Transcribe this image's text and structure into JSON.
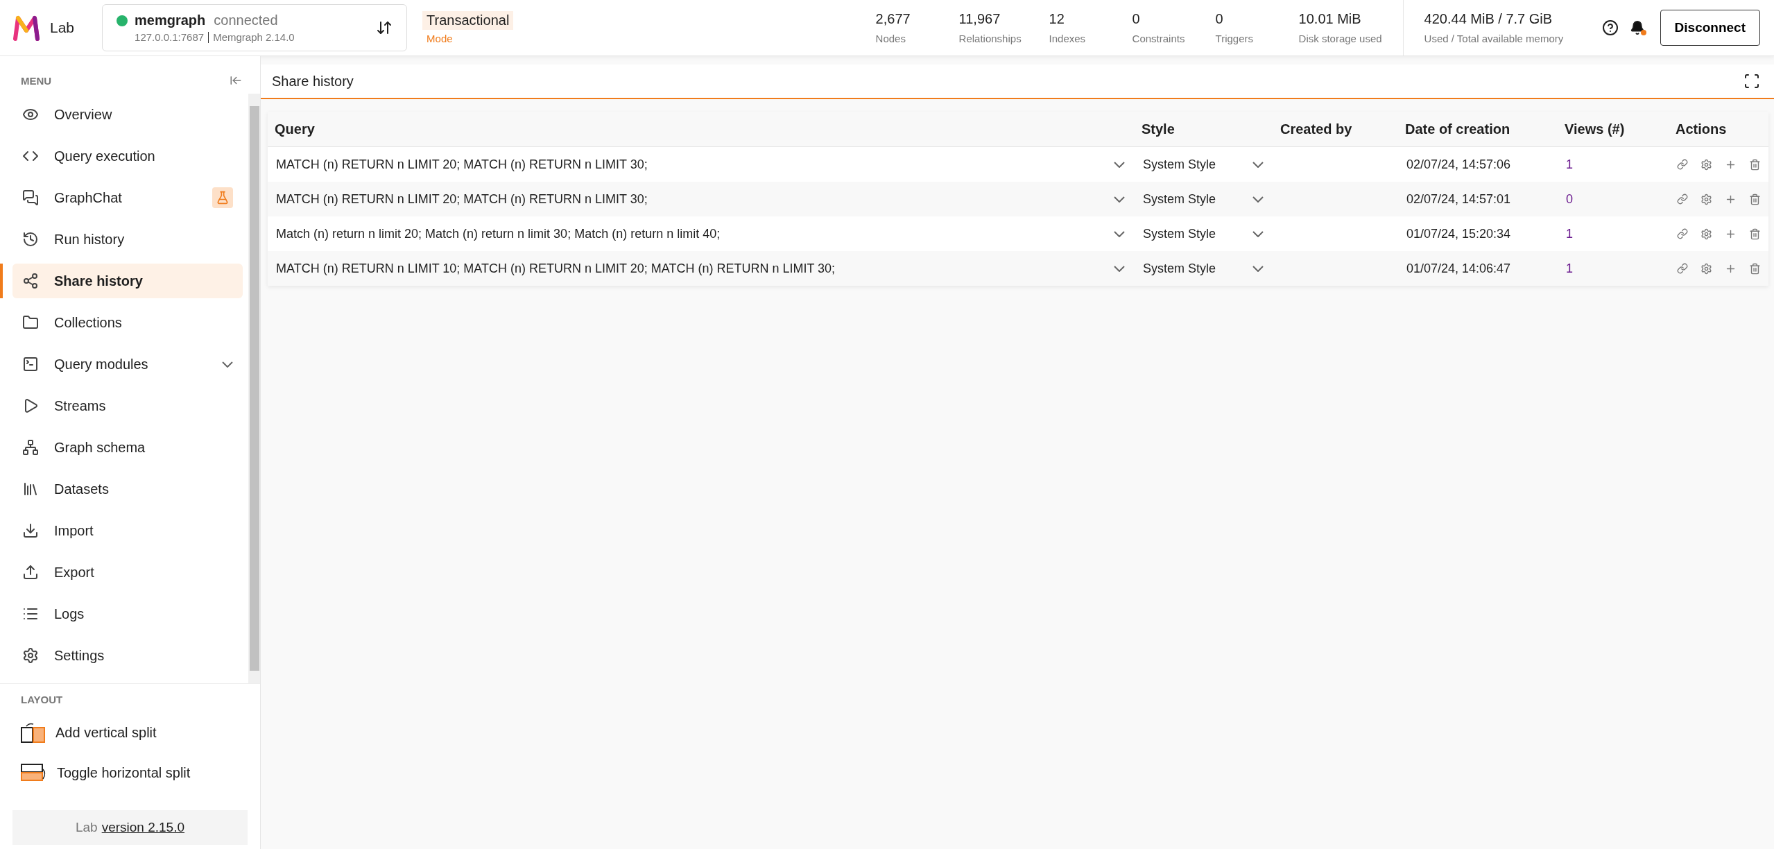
{
  "header": {
    "logo_text": "Lab",
    "connection": {
      "name": "memgraph",
      "status": "connected",
      "online": true,
      "address": "127.0.0.1:7687",
      "version": "Memgraph 2.14.0"
    },
    "mode": {
      "value": "Transactional",
      "label": "Mode"
    },
    "stats": [
      {
        "value": "2,677",
        "label": "Nodes"
      },
      {
        "value": "11,967",
        "label": "Relationships"
      },
      {
        "value": "12",
        "label": "Indexes"
      },
      {
        "value": "0",
        "label": "Constraints"
      },
      {
        "value": "0",
        "label": "Triggers"
      },
      {
        "value": "10.01 MiB",
        "label": "Disk storage used"
      }
    ],
    "memory": {
      "value": "420.44 MiB / 7.7 GiB",
      "label": "Used / Total available memory"
    },
    "notification_unread": true,
    "disconnect_button": "Disconnect"
  },
  "sidebar": {
    "menu_heading": "MENU",
    "items": [
      {
        "label": "Overview",
        "selected": false,
        "kind": "plain"
      },
      {
        "label": "Query execution",
        "selected": false,
        "kind": "plain"
      },
      {
        "label": "GraphChat",
        "selected": false,
        "kind": "badge"
      },
      {
        "label": "Run history",
        "selected": false,
        "kind": "plain"
      },
      {
        "label": "Share history",
        "selected": true,
        "kind": "plain"
      },
      {
        "label": "Collections",
        "selected": false,
        "kind": "plain"
      },
      {
        "label": "Query modules",
        "selected": false,
        "kind": "expandable",
        "expanded": false
      },
      {
        "label": "Streams",
        "selected": false,
        "kind": "plain"
      },
      {
        "label": "Graph schema",
        "selected": false,
        "kind": "plain"
      },
      {
        "label": "Datasets",
        "selected": false,
        "kind": "plain"
      },
      {
        "label": "Import",
        "selected": false,
        "kind": "plain"
      },
      {
        "label": "Export",
        "selected": false,
        "kind": "plain"
      },
      {
        "label": "Logs",
        "selected": false,
        "kind": "plain"
      },
      {
        "label": "Settings",
        "selected": false,
        "kind": "plain"
      }
    ],
    "layout_heading": "LAYOUT",
    "layout_items": [
      {
        "label": "Add vertical split"
      },
      {
        "label": "Toggle horizontal split"
      }
    ],
    "footer": {
      "prefix": "Lab",
      "link": "version 2.15.0"
    }
  },
  "panel": {
    "title": "Share history",
    "table": {
      "columns": [
        "Query",
        "Style",
        "Created by",
        "Date of creation",
        "Views (#)",
        "Actions"
      ],
      "rows": [
        {
          "query": "MATCH (n) RETURN n LIMIT 20; MATCH (n) RETURN n LIMIT 30;",
          "style": "System Style",
          "date": "02/07/24, 14:57:06",
          "views": "1"
        },
        {
          "query": "MATCH (n) RETURN n LIMIT 20; MATCH (n) RETURN n LIMIT 30;",
          "style": "System Style",
          "date": "02/07/24, 14:57:01",
          "views": "0"
        },
        {
          "query": "Match (n) return n limit 20; Match (n) return n limit 30; Match (n) return n limit 40;",
          "style": "System Style",
          "date": "01/07/24, 15:20:34",
          "views": "1"
        },
        {
          "query": "MATCH (n) RETURN n LIMIT 10; MATCH (n) RETURN n LIMIT 20; MATCH (n) RETURN n LIMIT 30;",
          "style": "System Style",
          "date": "01/07/24, 14:06:47",
          "views": "1"
        }
      ]
    }
  }
}
